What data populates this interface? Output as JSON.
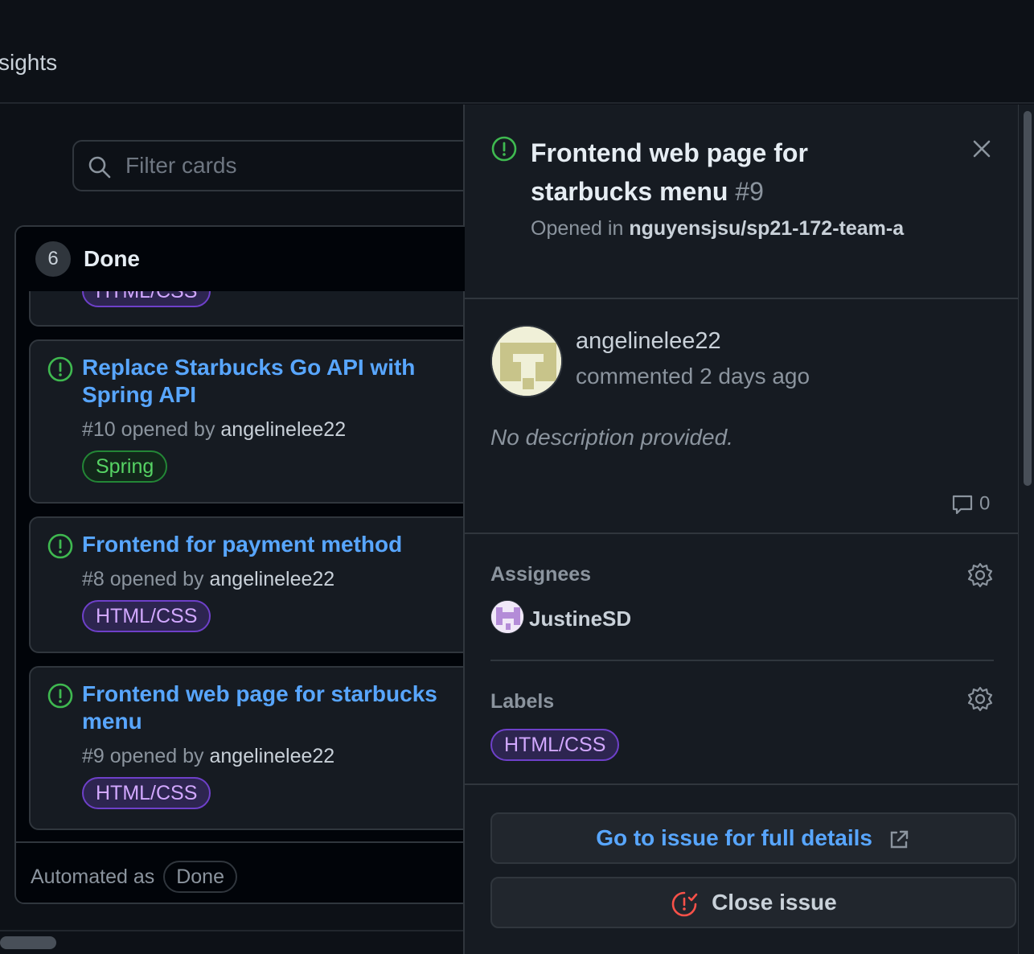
{
  "topbar": {
    "tab_label": "sights"
  },
  "filter": {
    "placeholder": "Filter cards"
  },
  "column": {
    "count": "6",
    "title": "Done",
    "footer_prefix": "Automated as",
    "footer_pill": "Done"
  },
  "cards": [
    {
      "label": "HTML/CSS"
    },
    {
      "title": "Replace Starbucks Go API with Spring API",
      "number": "#10",
      "opened_by_text": "opened by",
      "author": "angelinelee22",
      "label": "Spring"
    },
    {
      "title": "Frontend for payment method",
      "number": "#8",
      "opened_by_text": "opened by",
      "author": "angelinelee22",
      "label": "HTML/CSS"
    },
    {
      "title": "Frontend web page for starbucks menu",
      "number": "#9",
      "opened_by_text": "opened by",
      "author": "angelinelee22",
      "label": "HTML/CSS"
    }
  ],
  "panel": {
    "title": "Frontend web page for starbucks menu",
    "number": "#9",
    "opened_in_prefix": "Opened in",
    "repo": "nguyensjsu/sp21-172-team-a",
    "comment": {
      "user": "angelinelee22",
      "time": "commented 2 days ago",
      "description": "No description provided.",
      "comment_count": "0"
    },
    "assignees_title": "Assignees",
    "assignee": "JustineSD",
    "labels_title": "Labels",
    "label": "HTML/CSS",
    "go_to_issue_label": "Go to issue for full details",
    "close_issue_label": "Close issue"
  },
  "colors": {
    "accent_link": "#58a6ff",
    "open_issue_green": "#3fb950",
    "close_issue_red": "#f85149",
    "label_purple": "#d2a8ff",
    "label_green": "#56d364"
  },
  "icons": [
    "search-icon",
    "issue-opened-icon",
    "close-icon",
    "comment-icon",
    "gear-icon",
    "link-external-icon",
    "issue-closed-icon"
  ]
}
